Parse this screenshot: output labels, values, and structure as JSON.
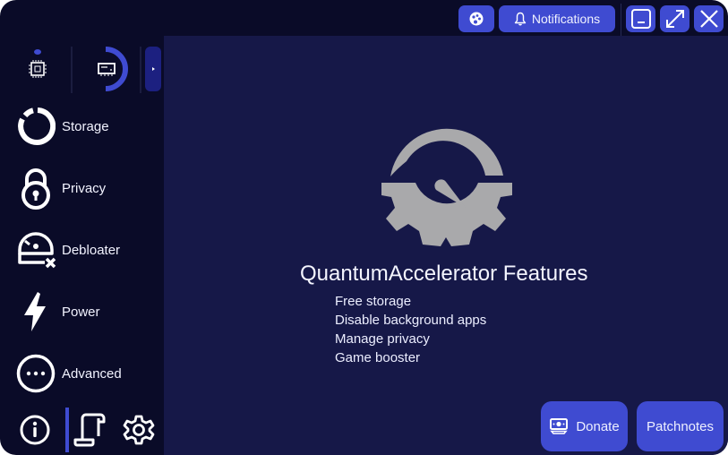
{
  "colors": {
    "window_bg": "#0a0b28",
    "content_bg": "#161848",
    "accent": "#3f4bd1",
    "icon_gray": "#a9a9ab",
    "text": "#f2f3ff"
  },
  "titlebar": {
    "theme_button": {
      "icon": "palette-icon"
    },
    "notifications_button": {
      "icon": "bell-icon",
      "label": "Notifications"
    },
    "minimize_button": {
      "icon": "minimize-icon"
    },
    "maximize_button": {
      "icon": "maximize-icon"
    },
    "close_button": {
      "icon": "close-icon"
    }
  },
  "sidebar": {
    "monitors": [
      {
        "name": "cpu",
        "icon": "cpu-icon",
        "usage_percent": 5
      },
      {
        "name": "ram",
        "icon": "ram-icon",
        "usage_percent": 45
      }
    ],
    "expand_icon": "chevron-right-icon",
    "items": [
      {
        "label": "Storage",
        "icon": "storage-ring-icon"
      },
      {
        "label": "Privacy",
        "icon": "lock-icon"
      },
      {
        "label": "Debloater",
        "icon": "debloater-gauge-icon"
      },
      {
        "label": "Power",
        "icon": "lightning-icon"
      },
      {
        "label": "Advanced",
        "icon": "more-circle-icon"
      }
    ],
    "bottom": [
      {
        "icon": "info-icon"
      },
      {
        "icon": "scroll-icon",
        "active": true
      },
      {
        "icon": "gear-icon"
      }
    ]
  },
  "main": {
    "logo_icon": "gear-gauge-logo-icon",
    "title": "QuantumAccelerator Features",
    "features": [
      "Free storage",
      "Disable background apps",
      "Manage privacy",
      "Game booster"
    ],
    "donate_button": {
      "label": "Donate",
      "icon": "money-icon"
    },
    "patchnotes_button": {
      "label": "Patchnotes"
    }
  }
}
